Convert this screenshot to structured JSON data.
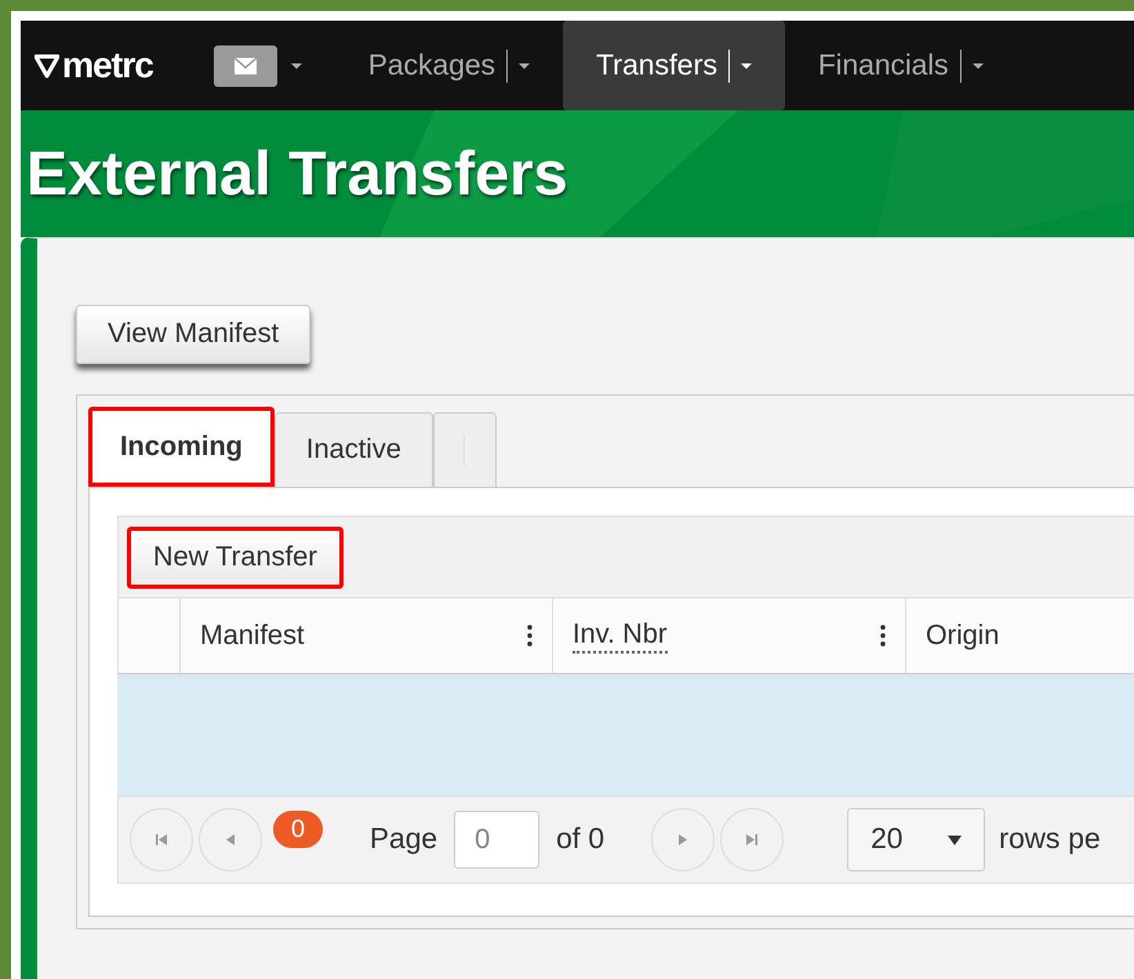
{
  "nav": {
    "logo": "metrc",
    "items": [
      {
        "label": "Packages",
        "selected": false
      },
      {
        "label": "Transfers",
        "selected": true
      },
      {
        "label": "Financials",
        "selected": false
      }
    ]
  },
  "page_title": "External Transfers",
  "view_manifest_button": "View Manifest",
  "tabs": [
    {
      "kind": "text",
      "label": "Incoming",
      "selected": true,
      "highlighted": true
    },
    {
      "kind": "text",
      "label": "Inactive",
      "selected": false,
      "highlighted": false
    },
    {
      "kind": "empty",
      "selected": false,
      "highlighted": false
    }
  ],
  "new_transfer_button": {
    "label": "New Transfer",
    "highlighted": true
  },
  "table": {
    "columns": [
      {
        "label": "Manifest",
        "underlined": false,
        "menu": true
      },
      {
        "label": "Inv. Nbr",
        "underlined": true,
        "menu": true
      },
      {
        "label": "Origin",
        "underlined": false,
        "menu": false
      }
    ]
  },
  "pager": {
    "count_badge": "0",
    "page_label": "Page",
    "page_value": "0",
    "of_label": "of 0",
    "page_size": "20",
    "rows_label": "rows pe"
  }
}
